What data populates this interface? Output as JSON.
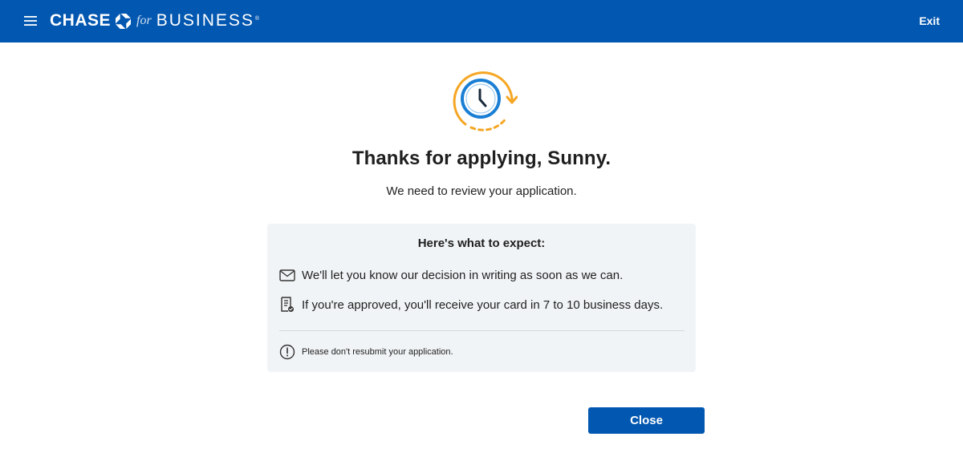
{
  "header": {
    "logo": {
      "brand": "CHASE",
      "for": "for",
      "business": "BUSINESS",
      "registered": "®"
    },
    "exit_label": "Exit",
    "background_color": "#0257b0"
  },
  "confirmation": {
    "title": "Thanks for applying, Sunny.",
    "subtitle": "We need to review your application."
  },
  "expect_card": {
    "title": "Here's what to expect:",
    "items": [
      {
        "icon": "envelope-icon",
        "text": "We'll let you know our decision in writing as soon as we can."
      },
      {
        "icon": "document-check-icon",
        "text": "If you're approved, you'll receive your card in 7 to 10 business days."
      }
    ],
    "notice": {
      "icon": "alert-circle-icon",
      "text": "Please don't resubmit your application."
    }
  },
  "actions": {
    "close_label": "Close"
  },
  "colors": {
    "primary_blue": "#0257b0",
    "clock_blue": "#1a7fd4",
    "clock_orange": "#f5a623",
    "card_background": "#f1f4f6"
  }
}
